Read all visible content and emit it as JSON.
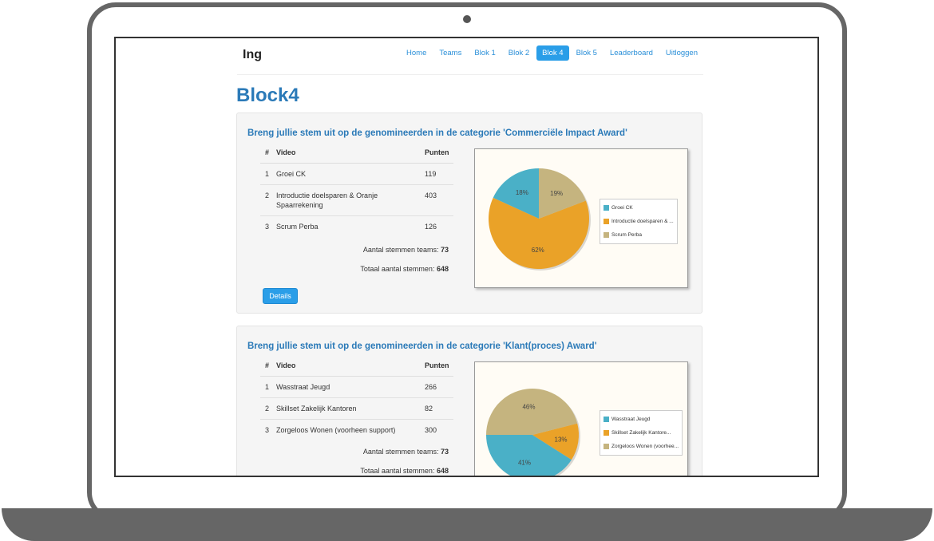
{
  "brand": "Ing",
  "nav": [
    {
      "label": "Home",
      "active": false
    },
    {
      "label": "Teams",
      "active": false
    },
    {
      "label": "Blok 1",
      "active": false
    },
    {
      "label": "Blok 2",
      "active": false
    },
    {
      "label": "Blok 4",
      "active": true
    },
    {
      "label": "Blok 5",
      "active": false
    },
    {
      "label": "Leaderboard",
      "active": false
    },
    {
      "label": "Uitloggen",
      "active": false
    }
  ],
  "page_title": "Block4",
  "table_headers": {
    "index": "#",
    "video": "Video",
    "points": "Punten"
  },
  "stats_labels": {
    "team_votes": "Aantal stemmen teams:",
    "total_votes": "Totaal aantal stemmen:"
  },
  "colors": {
    "blue": "#4ab0c7",
    "orange": "#eaa228",
    "tan": "#c5b47f"
  },
  "categories": [
    {
      "heading": "Breng jullie stem uit op de genomineerden in de categorie 'Commerciële Impact Award'",
      "rows": [
        {
          "index": "1",
          "video": "Groei CK",
          "points": "119"
        },
        {
          "index": "2",
          "video": "Introductie doelsparen & Oranje Spaarrekening",
          "points": "403"
        },
        {
          "index": "3",
          "video": "Scrum Perba",
          "points": "126"
        }
      ],
      "team_votes": "73",
      "total_votes": "648",
      "details_label": "Details",
      "legend": [
        "Groei CK",
        "Introductie doelsparen & ...",
        "Scrum Perba"
      ],
      "slices": [
        {
          "label": "18%",
          "value": 18,
          "color": "#4ab0c7"
        },
        {
          "label": "62%",
          "value": 62,
          "color": "#eaa228"
        },
        {
          "label": "19%",
          "value": 19,
          "color": "#c5b47f"
        }
      ]
    },
    {
      "heading": "Breng jullie stem uit op de genomineerden in de categorie 'Klant(proces) Award'",
      "rows": [
        {
          "index": "1",
          "video": "Wasstraat Jeugd",
          "points": "266"
        },
        {
          "index": "2",
          "video": "Skillset Zakelijk Kantoren",
          "points": "82"
        },
        {
          "index": "3",
          "video": "Zorgeloos Wonen (voorheen support)",
          "points": "300"
        }
      ],
      "team_votes": "73",
      "total_votes": "648",
      "legend": [
        "Wasstraat Jeugd",
        "Skillset Zakelijk Kantore...",
        "Zorgeloos Wonen (voorhee..."
      ],
      "slices": [
        {
          "label": "41%",
          "value": 41,
          "color": "#4ab0c7"
        },
        {
          "label": "13%",
          "value": 13,
          "color": "#eaa228"
        },
        {
          "label": "46%",
          "value": 46,
          "color": "#c5b47f"
        }
      ]
    }
  ]
}
